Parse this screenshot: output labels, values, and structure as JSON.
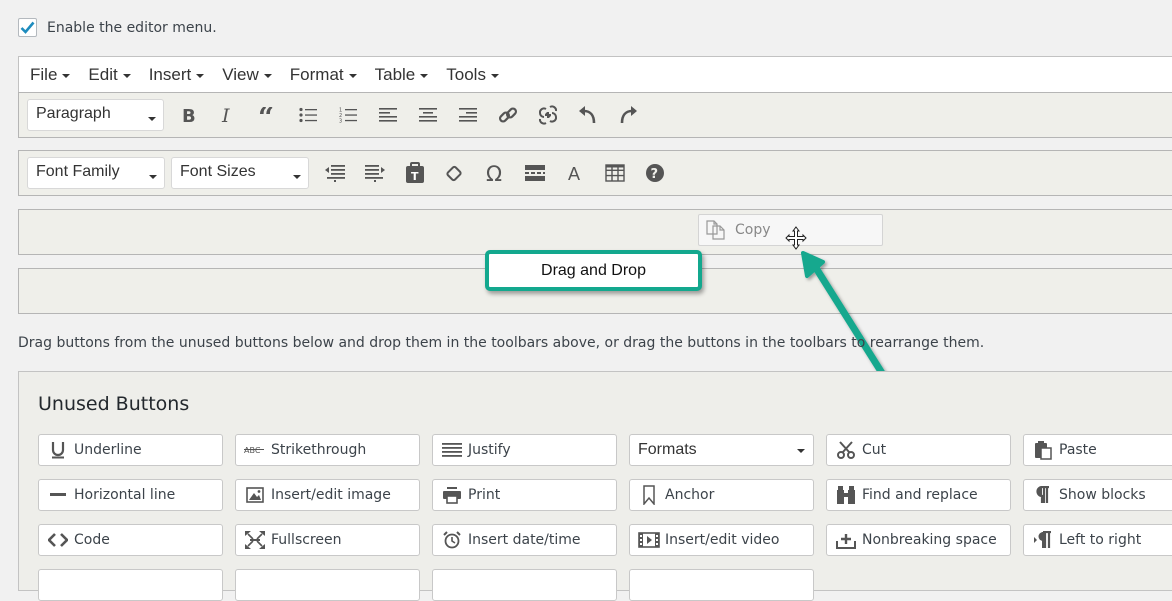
{
  "settings": {
    "enable_menu_label": "Enable the editor menu.",
    "enable_menu_checked": true
  },
  "menubar": {
    "items": [
      "File",
      "Edit",
      "Insert",
      "View",
      "Format",
      "Table",
      "Tools"
    ]
  },
  "toolbar1": {
    "block_format_select": "Paragraph",
    "buttons": [
      "bold",
      "italic",
      "blockquote",
      "bullet-list",
      "numbered-list",
      "align-left",
      "align-center",
      "align-right",
      "link",
      "unlink",
      "undo",
      "redo"
    ]
  },
  "toolbar2": {
    "font_family_select": "Font Family",
    "font_sizes_select": "Font Sizes",
    "buttons": [
      "outdent",
      "indent",
      "paste-as-text",
      "clear-formatting",
      "special-character",
      "read-more",
      "text-color",
      "table",
      "help"
    ]
  },
  "drag_ghost": {
    "label": "Copy",
    "icon": "copy-icon"
  },
  "callout": {
    "label": "Drag and Drop",
    "color": "#13a88e"
  },
  "instructions": "Drag buttons from the unused buttons below and drop them in the toolbars above, or drag the buttons in the toolbars to rearrange them.",
  "unused": {
    "title": "Unused Buttons",
    "buttons": [
      {
        "label": "Underline",
        "icon": "underline-icon"
      },
      {
        "label": "Strikethrough",
        "icon": "strikethrough-icon"
      },
      {
        "label": "Justify",
        "icon": "align-justify-icon"
      },
      {
        "label": "Formats",
        "icon": "dropdown"
      },
      {
        "label": "Cut",
        "icon": "scissors-icon"
      },
      {
        "label": "Paste",
        "icon": "paste-icon"
      },
      {
        "label": "Horizontal line",
        "icon": "horizontal-line-icon"
      },
      {
        "label": "Insert/edit image",
        "icon": "image-icon"
      },
      {
        "label": "Print",
        "icon": "printer-icon"
      },
      {
        "label": "Anchor",
        "icon": "bookmark-icon"
      },
      {
        "label": "Find and replace",
        "icon": "binoculars-icon"
      },
      {
        "label": "Show blocks",
        "icon": "pilcrow-icon"
      },
      {
        "label": "Code",
        "icon": "code-icon"
      },
      {
        "label": "Fullscreen",
        "icon": "fullscreen-icon"
      },
      {
        "label": "Insert date/time",
        "icon": "alarm-clock-icon"
      },
      {
        "label": "Insert/edit video",
        "icon": "video-icon"
      },
      {
        "label": "Nonbreaking space",
        "icon": "nonbreaking-icon"
      },
      {
        "label": "Left to right",
        "icon": "ltr-icon"
      }
    ]
  }
}
